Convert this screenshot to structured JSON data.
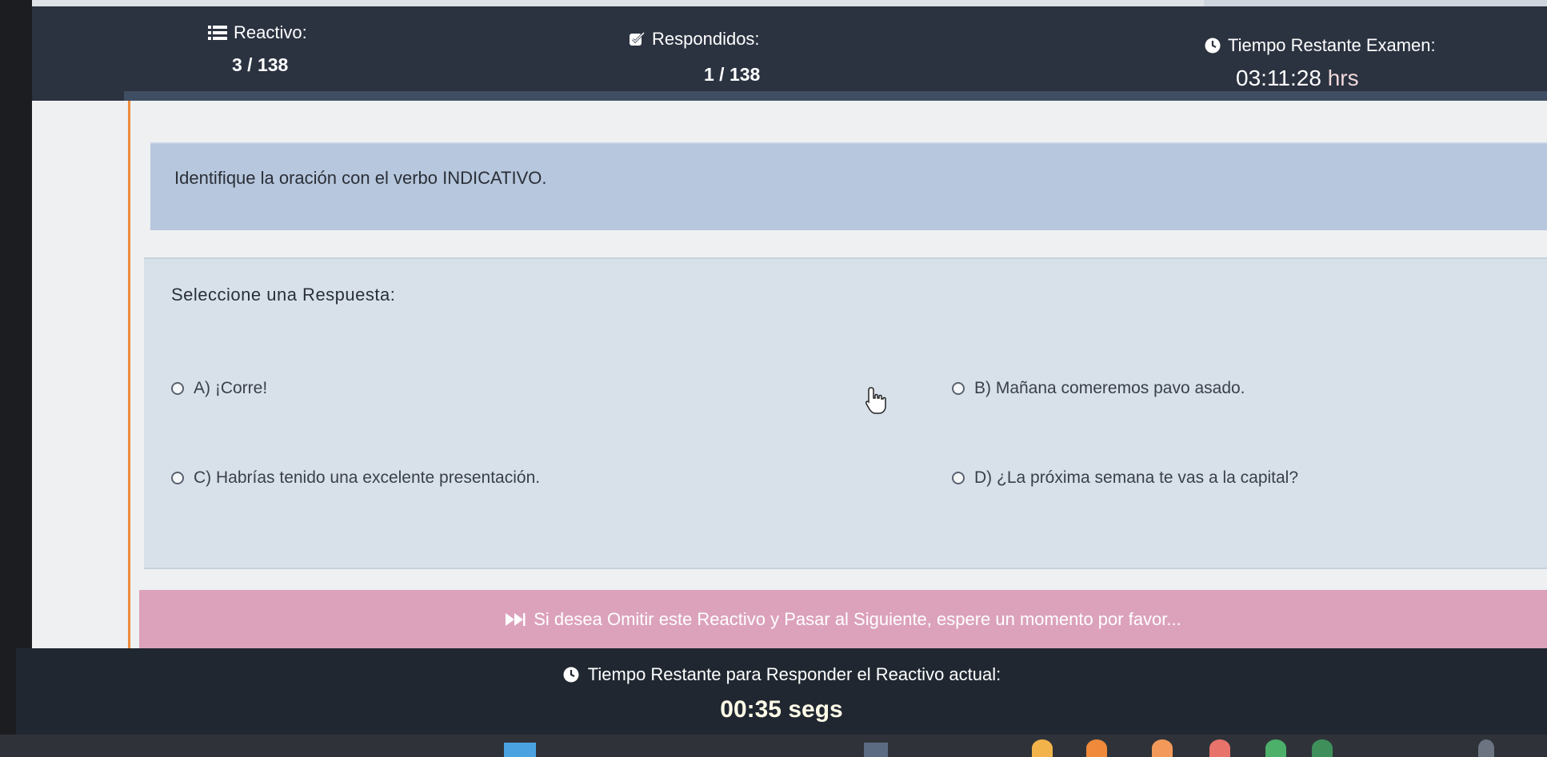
{
  "header": {
    "reactivo_label": "Reactivo:",
    "reactivo_value": "3 / 138",
    "respondidos_label": "Respondidos:",
    "respondidos_value": "1 / 138",
    "tiempo_examen_label": "Tiempo Restante Examen:",
    "tiempo_examen_value": "03:11:28",
    "tiempo_examen_unit": "hrs"
  },
  "question": {
    "text": "Identifique la oración con el verbo INDICATIVO."
  },
  "answers": {
    "title": "Seleccione una Respuesta:",
    "options": [
      {
        "label": "A) ¡Corre!"
      },
      {
        "label": "B) Mañana comeremos pavo asado."
      },
      {
        "label": "C) Habrías tenido una excelente presentación."
      },
      {
        "label": "D) ¿La próxima semana te vas a la capital?"
      }
    ]
  },
  "skip": {
    "text": "Si desea Omitir este Reactivo y Pasar al Siguiente, espere un momento por favor..."
  },
  "footer": {
    "label": "Tiempo Restante para Responder el Reactivo actual:",
    "timer": "00:35 segs"
  },
  "colors": {
    "header_bg": "#2b3240",
    "question_bg": "#b7c7dd",
    "answers_bg": "#d8e1ea",
    "skip_bg": "#dca2bb",
    "footer_bg": "#202731",
    "accent_line": "#f08a3a"
  }
}
